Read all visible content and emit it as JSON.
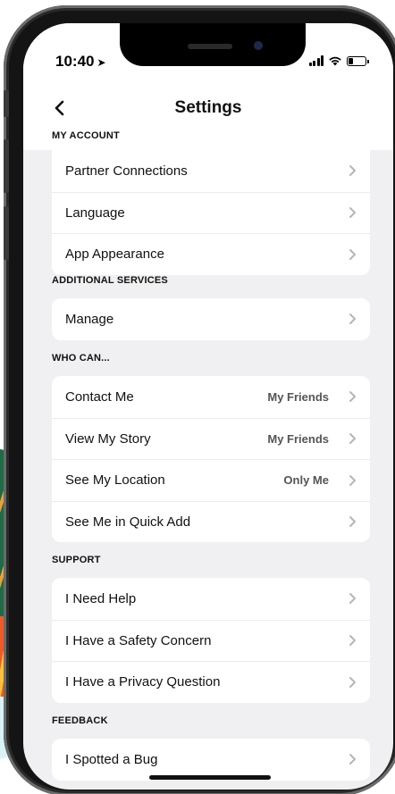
{
  "status_bar": {
    "time": "10:40",
    "location_arrow": "➤"
  },
  "nav": {
    "title": "Settings"
  },
  "sections": [
    {
      "label": "MY ACCOUNT",
      "rows": [
        {
          "label": "Partner Connections",
          "value": ""
        },
        {
          "label": "Language",
          "value": ""
        },
        {
          "label": "App Appearance",
          "value": ""
        }
      ]
    },
    {
      "label": "ADDITIONAL SERVICES",
      "rows": [
        {
          "label": "Manage",
          "value": ""
        }
      ]
    },
    {
      "label": "WHO CAN...",
      "rows": [
        {
          "label": "Contact Me",
          "value": "My Friends"
        },
        {
          "label": "View My Story",
          "value": "My Friends"
        },
        {
          "label": "See My Location",
          "value": "Only Me"
        },
        {
          "label": "See Me in Quick Add",
          "value": ""
        }
      ]
    },
    {
      "label": "SUPPORT",
      "rows": [
        {
          "label": "I Need Help",
          "value": ""
        },
        {
          "label": "I Have a Safety Concern",
          "value": ""
        },
        {
          "label": "I Have a Privacy Question",
          "value": ""
        }
      ]
    },
    {
      "label": "FEEDBACK",
      "rows": [
        {
          "label": "I Spotted a Bug",
          "value": ""
        }
      ]
    }
  ],
  "icons": {
    "back": "chevron-left-icon",
    "row_arrow": "chevron-right-icon"
  },
  "colors": {
    "screen_bg": "#f0f0f2",
    "card_bg": "#ffffff",
    "chevron": "#b5b5ba"
  }
}
